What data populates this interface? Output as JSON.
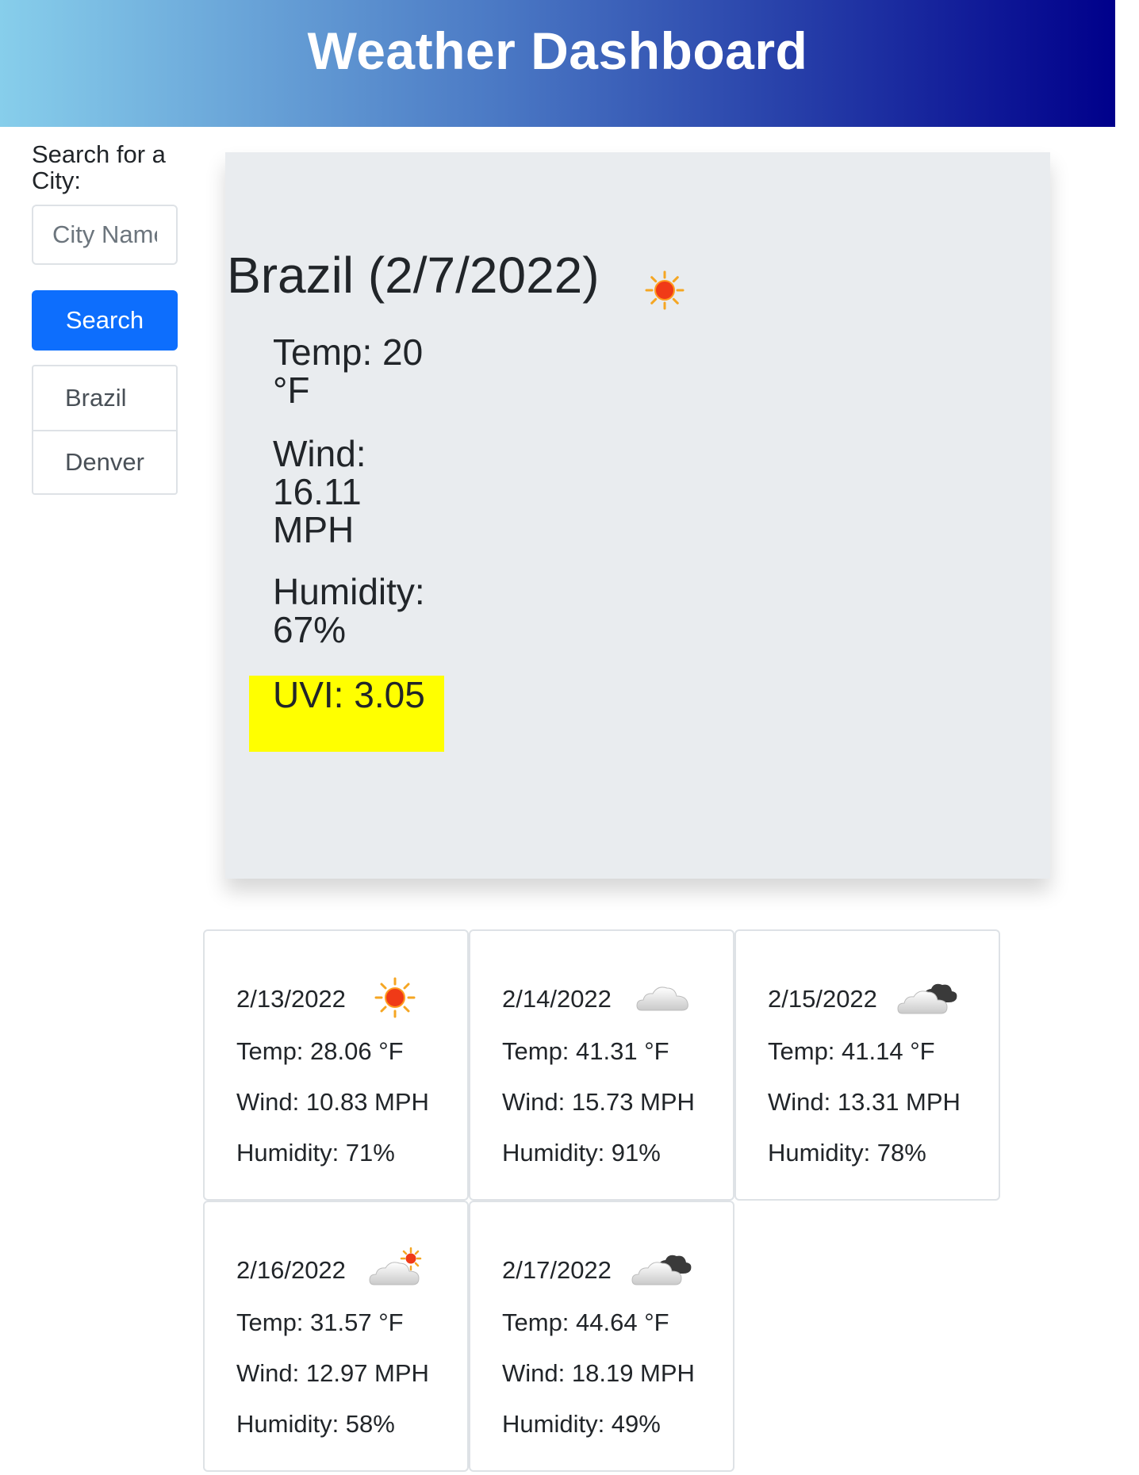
{
  "header": {
    "title": "Weather Dashboard"
  },
  "sidebar": {
    "label": "Search for a City:",
    "input_placeholder": "City Name",
    "input_value": "",
    "search_label": "Search",
    "history": [
      "Brazil",
      "Denver"
    ]
  },
  "current": {
    "title": "Brazil (2/7/2022)",
    "icon": "sun-icon",
    "temp": "Temp: 20 °F",
    "wind": "Wind: 16.11 MPH",
    "humidity": "Humidity: 67%",
    "uvi": "UVI: 3.05",
    "uvi_color": "#ffff00"
  },
  "forecast": [
    {
      "date": "2/13/2022",
      "icon": "sun-icon",
      "temp": "Temp: 28.06 °F",
      "wind": "Wind: 10.83 MPH",
      "humidity": "Humidity: 71%"
    },
    {
      "date": "2/14/2022",
      "icon": "cloud-icon",
      "temp": "Temp: 41.31 °F",
      "wind": "Wind: 15.73 MPH",
      "humidity": "Humidity: 91%"
    },
    {
      "date": "2/15/2022",
      "icon": "broken-clouds-icon",
      "temp": "Temp: 41.14 °F",
      "wind": "Wind: 13.31 MPH",
      "humidity": "Humidity: 78%"
    },
    {
      "date": "2/16/2022",
      "icon": "sun-behind-cloud-icon",
      "temp": "Temp: 31.57 °F",
      "wind": "Wind: 12.97 MPH",
      "humidity": "Humidity: 58%"
    },
    {
      "date": "2/17/2022",
      "icon": "broken-clouds-icon",
      "temp": "Temp: 44.64 °F",
      "wind": "Wind: 18.19 MPH",
      "humidity": "Humidity: 49%"
    }
  ],
  "colors": {
    "header_gradient": [
      "#87ceeb",
      "#00008b"
    ],
    "search_button": "#0d6efd",
    "current_bg": "#e9ecef"
  }
}
